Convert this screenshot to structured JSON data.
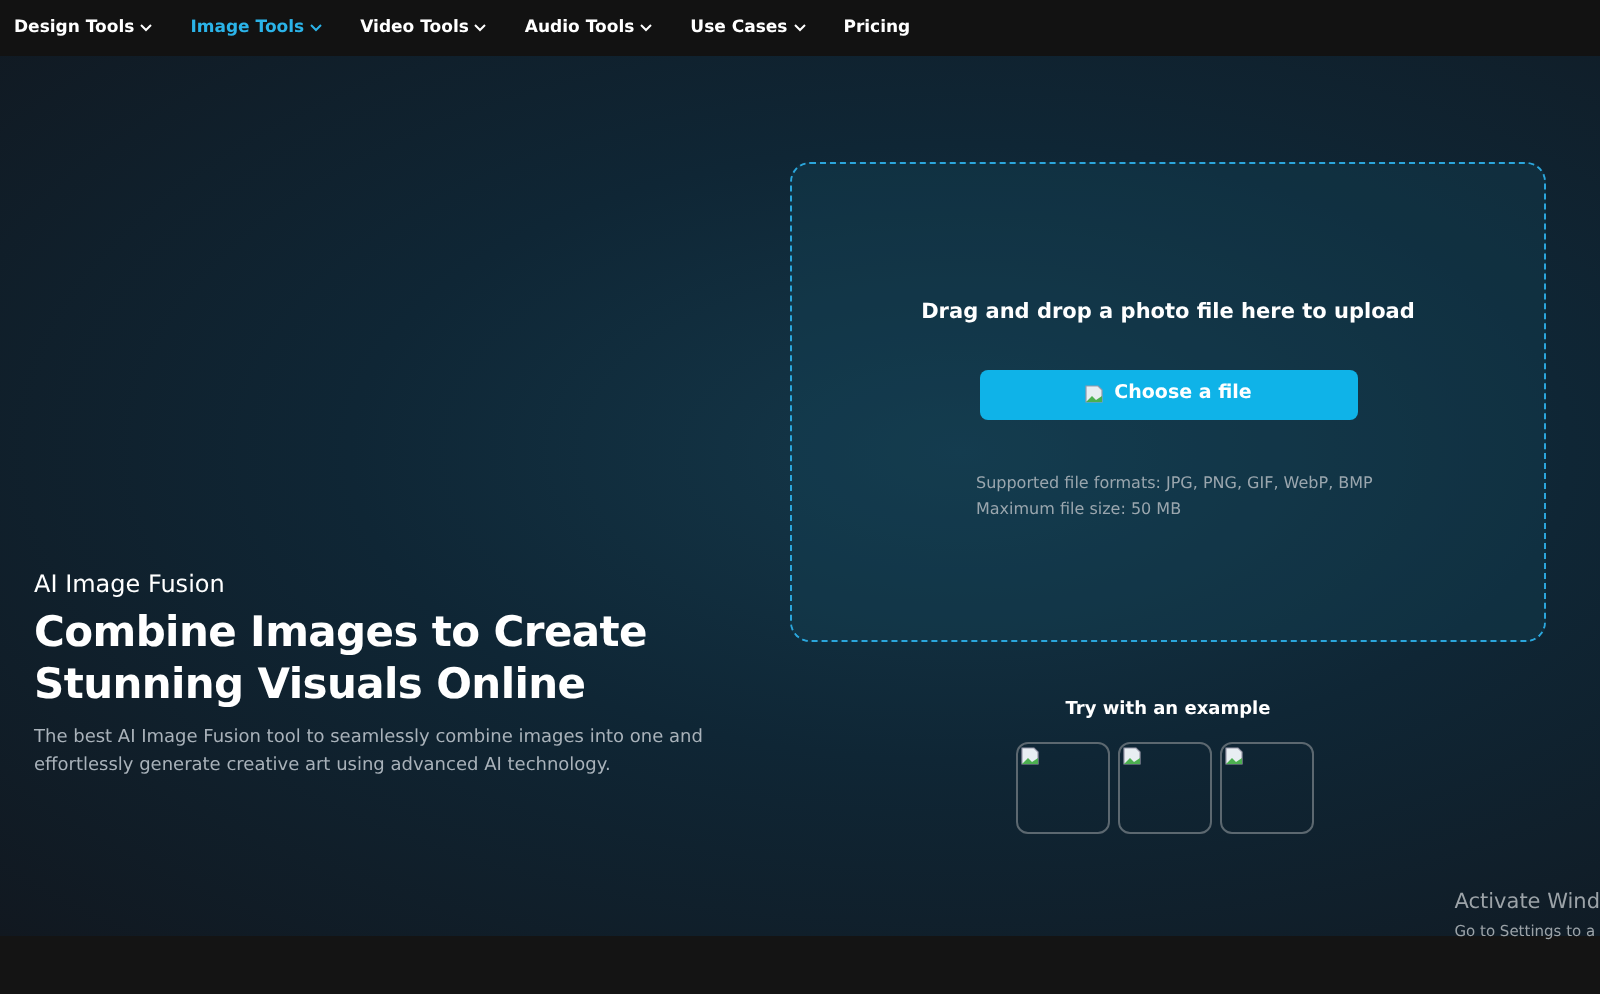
{
  "nav": [
    {
      "label": "Design Tools",
      "has_menu": true,
      "selected": false
    },
    {
      "label": "Image Tools",
      "has_menu": true,
      "selected": true
    },
    {
      "label": "Video Tools",
      "has_menu": true,
      "selected": false
    },
    {
      "label": "Audio Tools",
      "has_menu": true,
      "selected": false
    },
    {
      "label": "Use Cases",
      "has_menu": true,
      "selected": false
    },
    {
      "label": "Pricing",
      "has_menu": false,
      "selected": false
    }
  ],
  "hero": {
    "eyebrow": "AI Image Fusion",
    "title": "Combine Images to Create Stunning Visuals Online",
    "description": "The best AI Image Fusion tool to seamlessly combine images into one and effortlessly generate creative art using advanced AI technology."
  },
  "upload": {
    "prompt": "Drag and drop a photo file here to upload",
    "button": "Choose a file",
    "formats": "Supported file formats: JPG, PNG, GIF, WebP, BMP",
    "max_size": "Maximum file size: 50 MB"
  },
  "examples": {
    "title": "Try with an example",
    "items": [
      {
        "kind": "broken-image"
      },
      {
        "kind": "broken-image"
      },
      {
        "kind": "broken-image"
      }
    ]
  },
  "os_notice": {
    "title": "Activate Wind",
    "subtitle": "Go to Settings to a"
  }
}
